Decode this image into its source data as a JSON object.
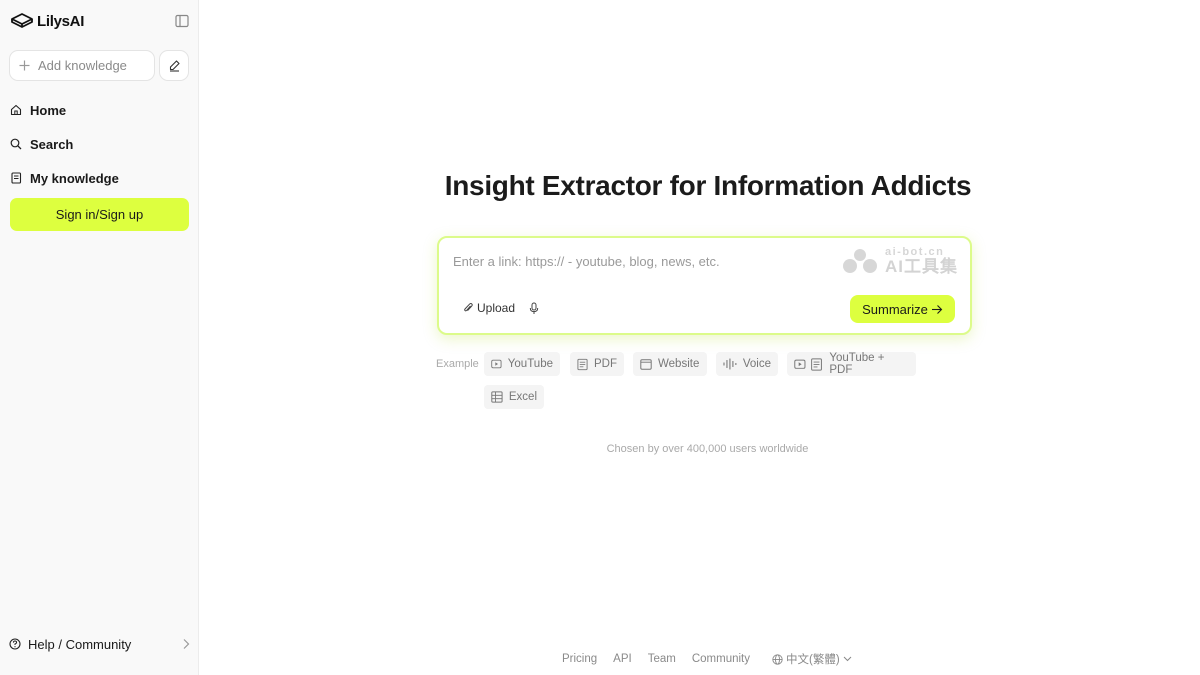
{
  "sidebar": {
    "logo_text": "LilysAI",
    "add_knowledge_label": "Add knowledge",
    "nav": [
      {
        "label": "Home",
        "icon": "home-icon"
      },
      {
        "label": "Search",
        "icon": "search-icon"
      },
      {
        "label": "My knowledge",
        "icon": "notebook-icon"
      }
    ],
    "signin_label": "Sign in/Sign up",
    "help_label": "Help / Community"
  },
  "main": {
    "headline": "Insight Extractor for Information Addicts",
    "input": {
      "placeholder": "Enter a link: https:// - youtube, blog, news, etc.",
      "value": ""
    },
    "upload_label": "Upload",
    "summarize_label": "Summarize",
    "watermark": {
      "top": "ai-bot.cn",
      "bottom": "AI工具集"
    },
    "examples_label": "Example",
    "examples": [
      {
        "label": "YouTube",
        "icon": "video-icon"
      },
      {
        "label": "PDF",
        "icon": "document-icon"
      },
      {
        "label": "Website",
        "icon": "browser-icon"
      },
      {
        "label": "Voice",
        "icon": "waveform-icon"
      },
      {
        "label": "YouTube + PDF",
        "icon": "video-document-icon"
      },
      {
        "label": "Excel",
        "icon": "table-icon"
      }
    ],
    "chosen_text": "Chosen by over 400,000 users worldwide"
  },
  "footer": {
    "links": [
      "Pricing",
      "API",
      "Team",
      "Community"
    ],
    "language": "中文(繁體)"
  },
  "colors": {
    "accent": "#ddff3f",
    "card_border": "#dcfb8a"
  }
}
